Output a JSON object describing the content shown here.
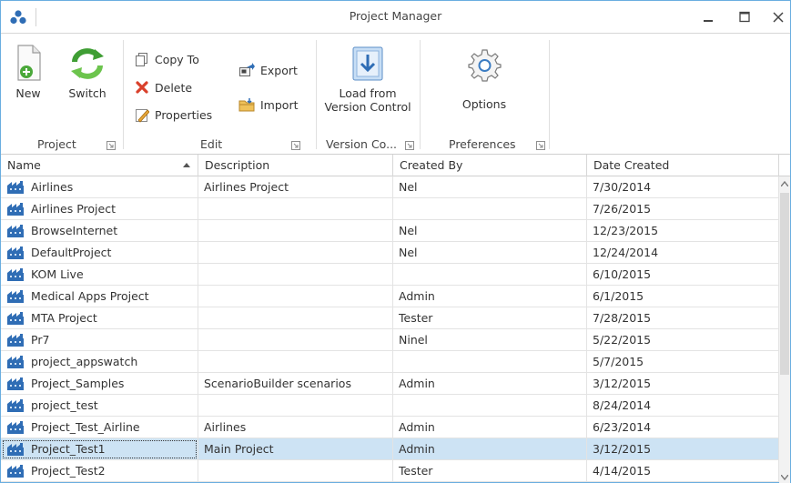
{
  "window": {
    "title": "Project Manager",
    "icons": [
      "app-logo-icon",
      "minimize-icon",
      "maximize-icon",
      "close-icon"
    ]
  },
  "ribbon": {
    "project": {
      "label": "Project",
      "new_label": "New",
      "switch_label": "Switch"
    },
    "edit": {
      "label": "Edit",
      "copy_to_label": "Copy To",
      "delete_label": "Delete",
      "properties_label": "Properties",
      "export_label": "Export",
      "import_label": "Import"
    },
    "version_control": {
      "label": "Version Co...",
      "load_line1": "Load from",
      "load_line2": "Version Control"
    },
    "preferences": {
      "label": "Preferences",
      "options_label": "Options"
    }
  },
  "grid": {
    "columns": [
      "Name",
      "Description",
      "Created By",
      "Date Created"
    ],
    "sorted_column": "Name",
    "rows": [
      {
        "name": "Airlines",
        "description": "Airlines Project",
        "created_by": "Nel",
        "date": "7/30/2014"
      },
      {
        "name": "Airlines Project",
        "description": "",
        "created_by": "",
        "date": "7/26/2015"
      },
      {
        "name": "BrowseInternet",
        "description": "",
        "created_by": "Nel",
        "date": "12/23/2015"
      },
      {
        "name": "DefaultProject",
        "description": "",
        "created_by": "Nel",
        "date": "12/24/2014"
      },
      {
        "name": "KOM Live",
        "description": "",
        "created_by": "",
        "date": "6/10/2015"
      },
      {
        "name": "Medical Apps Project",
        "description": "",
        "created_by": "Admin",
        "date": "6/1/2015"
      },
      {
        "name": "MTA Project",
        "description": "",
        "created_by": "Tester",
        "date": "7/28/2015"
      },
      {
        "name": "Pr7",
        "description": "",
        "created_by": "Ninel",
        "date": "5/22/2015"
      },
      {
        "name": "project_appswatch",
        "description": "",
        "created_by": "",
        "date": "5/7/2015"
      },
      {
        "name": "Project_Samples",
        "description": "ScenarioBuilder scenarios",
        "created_by": "Admin",
        "date": "3/12/2015"
      },
      {
        "name": "project_test",
        "description": "",
        "created_by": "",
        "date": "8/24/2014"
      },
      {
        "name": "Project_Test_Airline",
        "description": "Airlines",
        "created_by": "Admin",
        "date": "6/23/2014"
      },
      {
        "name": "Project_Test1",
        "description": "Main Project",
        "created_by": "Admin",
        "date": "3/12/2015"
      },
      {
        "name": "Project_Test2",
        "description": "",
        "created_by": "Tester",
        "date": "4/14/2015"
      }
    ],
    "selected_row": "Project_Test1"
  },
  "colors": {
    "window_border": "#6aaee0",
    "selection": "#cde3f4",
    "icon_blue": "#2f6db5"
  }
}
